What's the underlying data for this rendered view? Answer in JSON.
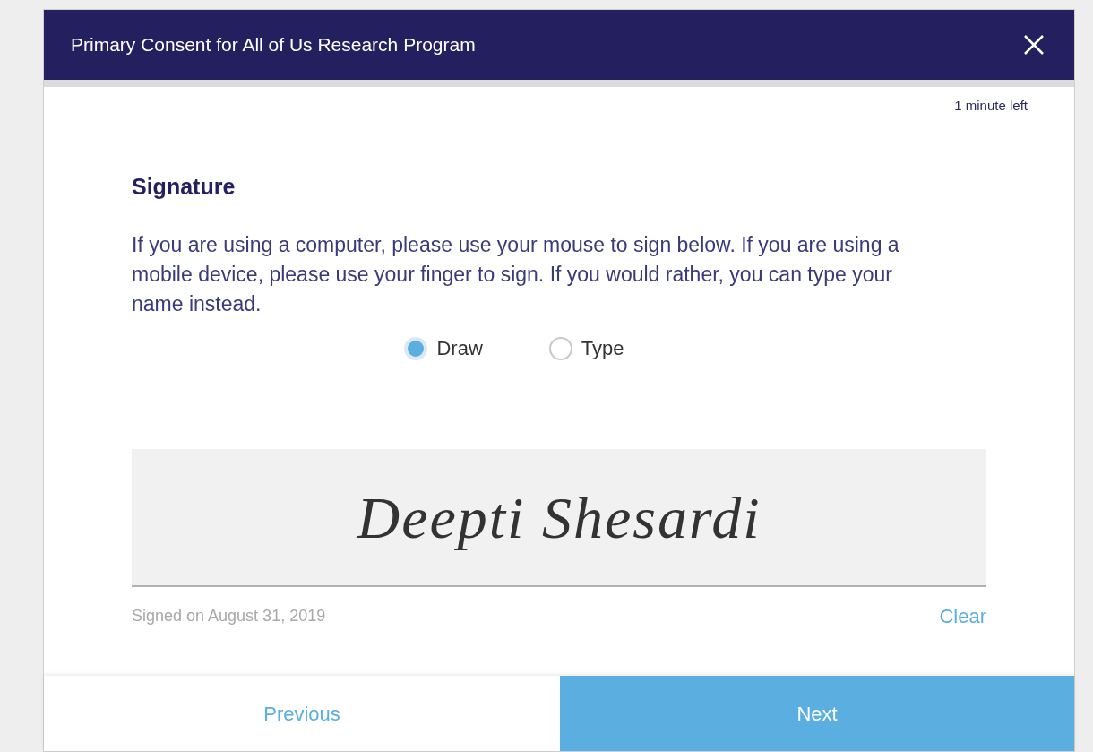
{
  "dialog": {
    "title": "Primary Consent for All of Us Research Program",
    "time_left": "1 minute left"
  },
  "section": {
    "heading": "Signature",
    "instructions": "If you are using a computer, please use your mouse to sign below. If you are using a mobile device, please use your finger to sign. If you would rather, you can type your name instead."
  },
  "mode_options": [
    {
      "label": "Draw",
      "selected": true
    },
    {
      "label": "Type",
      "selected": false
    }
  ],
  "signature": {
    "value": "Deepti Shesardi",
    "signed_on": "Signed on August 31, 2019",
    "clear": "Clear"
  },
  "footer": {
    "previous": "Previous",
    "next": "Next"
  }
}
